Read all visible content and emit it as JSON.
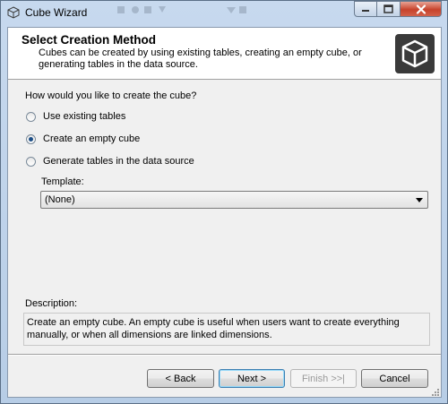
{
  "window": {
    "title": "Cube Wizard"
  },
  "header": {
    "title": "Select Creation Method",
    "description": "Cubes can be created by using existing tables, creating an empty cube, or generating tables in the data source.",
    "icon": "cube-icon"
  },
  "form": {
    "question": "How would you like to create the cube?",
    "options": [
      {
        "label": "Use existing tables",
        "selected": false
      },
      {
        "label": "Create an empty cube",
        "selected": true
      },
      {
        "label": "Generate tables in the data source",
        "selected": false
      }
    ],
    "template_label": "Template:",
    "template_value": "(None)",
    "description_label": "Description:",
    "description_text": "Create an empty cube. An empty cube is useful when users want to create everything manually, or when all dimensions are linked dimensions."
  },
  "buttons": {
    "back": "< Back",
    "next": "Next >",
    "finish": "Finish >>|",
    "cancel": "Cancel"
  },
  "colors": {
    "accent": "#1c4e86",
    "close_button": "#c7432c"
  }
}
